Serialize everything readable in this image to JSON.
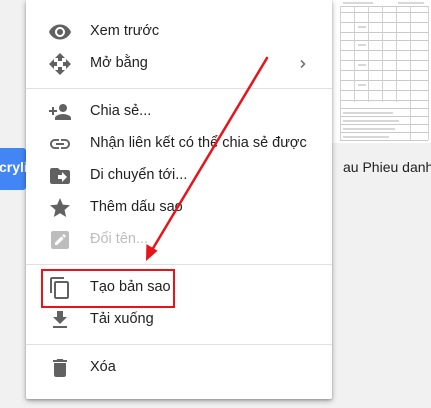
{
  "background": {
    "chip_text": "cryli...",
    "file_name": "au Phieu danh"
  },
  "menu": {
    "items": [
      {
        "name": "preview",
        "label": "Xem trước",
        "icon": "eye-icon",
        "enabled": true
      },
      {
        "name": "open-with",
        "label": "Mở bằng",
        "icon": "open-with-arrows-icon",
        "enabled": true,
        "has_submenu": true
      },
      {
        "name": "share",
        "label": "Chia sẻ...",
        "icon": "person-add-icon",
        "enabled": true
      },
      {
        "name": "get-shareable-link",
        "label": "Nhận liên kết có thể chia sẻ được",
        "icon": "link-icon",
        "enabled": true
      },
      {
        "name": "move-to",
        "label": "Di chuyển tới...",
        "icon": "folder-move-icon",
        "enabled": true
      },
      {
        "name": "add-star",
        "label": "Thêm dấu sao",
        "icon": "star-icon",
        "enabled": true
      },
      {
        "name": "rename",
        "label": "Đổi tên...",
        "icon": "pencil-icon",
        "enabled": false
      },
      {
        "name": "make-copy",
        "label": "Tạo bản sao",
        "icon": "copy-icon",
        "enabled": true,
        "highlighted": true
      },
      {
        "name": "download",
        "label": "Tải xuống",
        "icon": "download-icon",
        "enabled": true
      },
      {
        "name": "remove",
        "label": "Xóa",
        "icon": "trash-icon",
        "enabled": true
      }
    ]
  },
  "colors": {
    "icon": "#616161",
    "icon_disabled": "#bdbdbd",
    "text": "#212121",
    "text_disabled": "#bdbdbd",
    "annotation_red": "#e8141a",
    "chip_blue": "#4285f4"
  }
}
